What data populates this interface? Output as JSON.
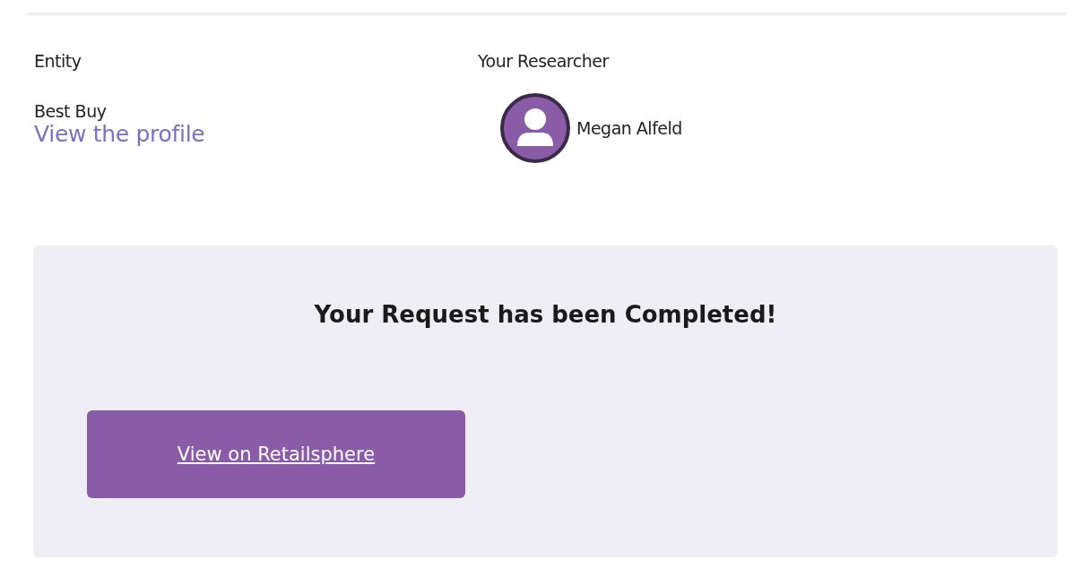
{
  "entity": {
    "label": "Entity",
    "name": "Best Buy",
    "link": "View the profile"
  },
  "researcher": {
    "label": "Your Researcher",
    "name": "Megan Alfeld"
  },
  "panel": {
    "heading": "Your Request has been Completed!",
    "button": "View on Retailsphere"
  }
}
